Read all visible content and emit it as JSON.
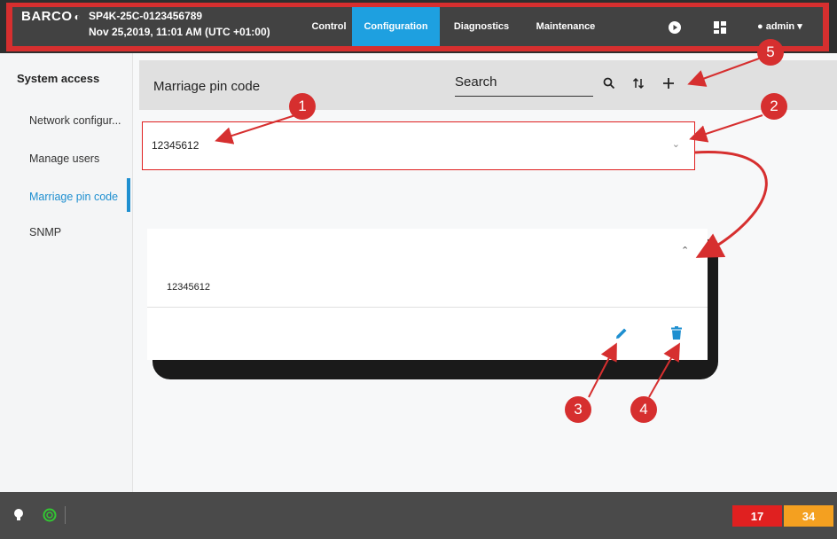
{
  "topbar": {
    "logo": "BARCO",
    "device_id": "SP4K-25C-0123456789",
    "datetime": "Nov 25,2019, 11:01 AM (UTC +01:00)",
    "tabs": [
      {
        "label": "Control"
      },
      {
        "label": "Configuration"
      },
      {
        "label": "Diagnostics"
      },
      {
        "label": "Maintenance"
      }
    ],
    "active_tab": "Configuration",
    "user": "admin"
  },
  "sidebar": {
    "title": "System access",
    "items": [
      {
        "label": "Network configur..."
      },
      {
        "label": "Manage users"
      },
      {
        "label": "Marriage pin code"
      },
      {
        "label": "SNMP"
      }
    ],
    "active_item": "Marriage pin code"
  },
  "main": {
    "title": "Marriage pin code",
    "search_label": "Search",
    "row_value": "12345612",
    "expanded_value": "12345612"
  },
  "callouts": [
    "1",
    "2",
    "3",
    "4",
    "5"
  ],
  "bottombar": {
    "error_count": "17",
    "warning_count": "34"
  },
  "colors": {
    "accent_blue": "#1ea0e0",
    "callout_red": "#d62f2f",
    "error_badge": "#e02020",
    "warning_badge": "#f4a020"
  }
}
